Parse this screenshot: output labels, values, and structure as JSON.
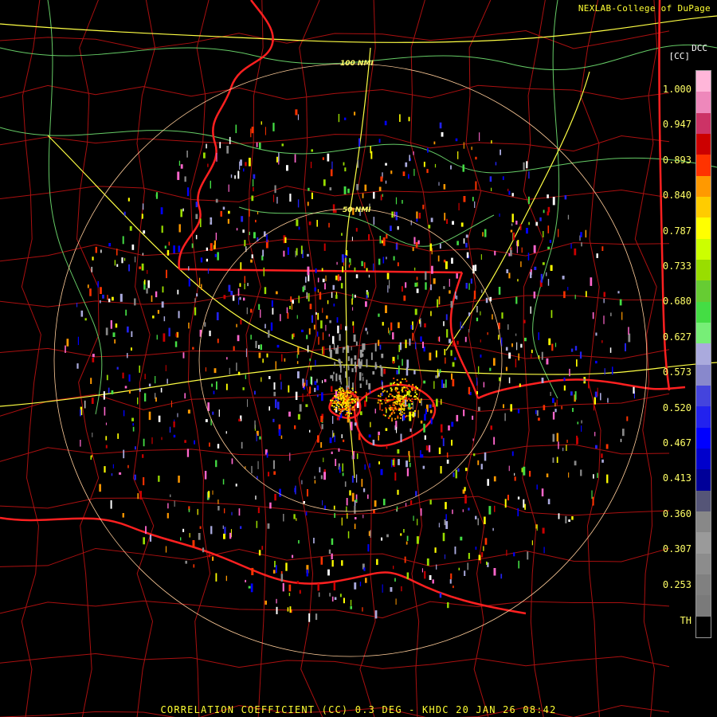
{
  "header": {
    "credit": "NEXLAB-College of DuPage",
    "product_code": "DCC",
    "unit": "[CC]"
  },
  "range_rings": {
    "inner_label": "50 NMI",
    "outer_label": "100 NMI"
  },
  "legend": {
    "ticks": [
      "1.000",
      "0.947",
      "0.893",
      "0.840",
      "0.787",
      "0.733",
      "0.680",
      "0.627",
      "0.573",
      "0.520",
      "0.467",
      "0.413",
      "0.360",
      "0.307",
      "0.253"
    ],
    "threshold_label": "TH",
    "colors": [
      "#ffb6d9",
      "#ee88bb",
      "#cc3366",
      "#cc0000",
      "#ff3300",
      "#ff9900",
      "#ffcc00",
      "#ffff00",
      "#ccff00",
      "#99dd00",
      "#66cc33",
      "#44dd44",
      "#77ee77",
      "#aaaadd",
      "#8888cc",
      "#4444dd",
      "#2222ee",
      "#0000ff",
      "#0000cc",
      "#000099",
      "#555577",
      "#888888",
      "#9a9a9a",
      "#8c8c8c",
      "#808080",
      "#7a7a7a",
      "#000000"
    ]
  },
  "footer": {
    "caption": "CORRELATION COEFFICIENT (CC) 0.3 DEG - KHDC 20 JAN 26 08:42"
  },
  "colors": {
    "state_border": "#ff2020",
    "county_border": "#aa1010",
    "highway": "#ffff44",
    "river": "#66cc66",
    "range_ring": "#ffcc99"
  }
}
